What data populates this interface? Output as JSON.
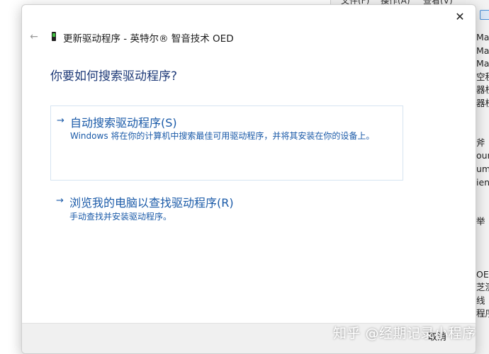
{
  "background_window": {
    "menu_items": [
      "文件(F)",
      "操作(A)",
      "查看(V)"
    ],
    "list_fragments": [
      "Ma",
      "Ma",
      "Ma",
      "空程",
      "器校",
      "器校",
      "",
      "",
      "斧",
      "ound",
      "um",
      "ient",
      "",
      "",
      "举",
      "",
      "",
      "",
      "OED",
      "芝测",
      "线",
      "程序"
    ]
  },
  "dialog": {
    "close_glyph": "✕",
    "back_glyph": "←",
    "title": "更新驱动程序 - 英特尔® 智音技术 OED",
    "question": "你要如何搜索驱动程序?",
    "options": [
      {
        "arrow": "→",
        "title": "自动搜索驱动程序(S)",
        "description": "Windows 将在你的计算机中搜索最佳可用驱动程序，并将其安装在你的设备上。"
      },
      {
        "arrow": "→",
        "title": "浏览我的电脑以查找驱动程序(R)",
        "description": "手动查找并安装驱动程序。"
      }
    ],
    "cancel_label": "取消"
  },
  "watermark": "知乎 @经期记录小程序",
  "colors": {
    "link_blue": "#1a5aa8",
    "question_blue": "#1e3a78",
    "footer_gray": "#f0f0f0"
  }
}
